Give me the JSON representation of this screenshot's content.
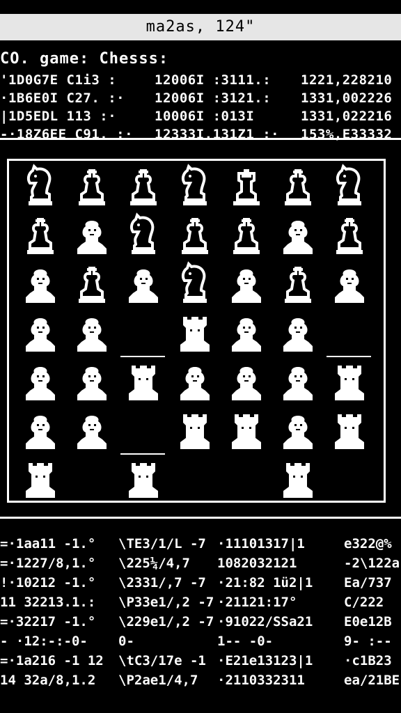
{
  "window": {
    "title": "ma2as, 124\""
  },
  "game_label": "CO. game: Chesss:",
  "top_table": {
    "rows": [
      [
        "'1D0G7E C1i3 :",
        "12006I :3111.:",
        "1221,228210"
      ],
      [
        "·1B6E0I C27. :·",
        "12006I :3121.:",
        "1331,002226"
      ],
      [
        "|1D5EDL 113 :·",
        "10006I :013I",
        "1331,022216"
      ],
      [
        "-·18Z6EE C91. :·",
        "12333I.131Z1 :·",
        "153%,E33332"
      ]
    ]
  },
  "board": {
    "columns": 7,
    "rows": [
      [
        "knight-outline",
        "bishop-outline",
        "bishop-outline",
        "knight-outline",
        "rook-outline",
        "bishop-outline",
        "knight-outline"
      ],
      [
        "bishop-outline",
        "pawn-filled",
        "knight-outline",
        "bishop-outline",
        "bishop-outline",
        "pawn-filled",
        "bishop-outline"
      ],
      [
        "pawn-filled",
        "bishop-outline",
        "pawn-filled",
        "knight-outline",
        "pawn-filled",
        "bishop-outline",
        "pawn-filled"
      ],
      [
        "pawn-filled",
        "pawn-filled",
        "empty-underline",
        "rook-filled",
        "pawn-filled",
        "pawn-filled",
        "empty-underline"
      ],
      [
        "pawn-filled",
        "pawn-filled",
        "rook-filled",
        "pawn-filled",
        "pawn-filled",
        "pawn-filled",
        "rook-filled"
      ],
      [
        "pawn-filled",
        "pawn-filled",
        "empty-underline",
        "rook-filled",
        "rook-filled",
        "pawn-filled",
        "rook-filled"
      ],
      [
        "rook-filled",
        "empty",
        "rook-filled",
        "empty",
        "empty",
        "rook-filled",
        "empty"
      ]
    ]
  },
  "bottom_table": {
    "rows": [
      [
        "=·1aa11 -1.°",
        "\\TE3/1/L -7",
        "·11101317|1",
        "e322@%"
      ],
      [
        "=·1227/8,1.°",
        "\\225¼/4,7",
        "1082032121",
        "-2\\122a"
      ],
      [
        "!·10212 -1.°",
        "\\2331/,7 -7",
        "·21:82 1ü2|1",
        "Ea/737"
      ],
      [
        "11 32213.1.:",
        "\\P33e1/,2 -7",
        "·21121:17°",
        "C/222"
      ],
      [
        "=·32217 -1.°",
        "\\229e1/,2 -7",
        "·91022/SSa21",
        "E0e12B"
      ],
      [
        "- ·12:-:-0-",
        "0-",
        "1-- -0- ",
        "9- :--"
      ],
      [
        "=·1a216 -1 12",
        "\\tC3/17e -1",
        "·E21e13123|1",
        "·c1B23"
      ],
      [
        "14 32a/8,1.2",
        "\\P2ae1/4,7",
        "·2110332311",
        "ea/21BE"
      ]
    ]
  },
  "colors": {
    "background": "#000000",
    "foreground": "#ffffff",
    "titlebar": "#e6e6e6"
  }
}
